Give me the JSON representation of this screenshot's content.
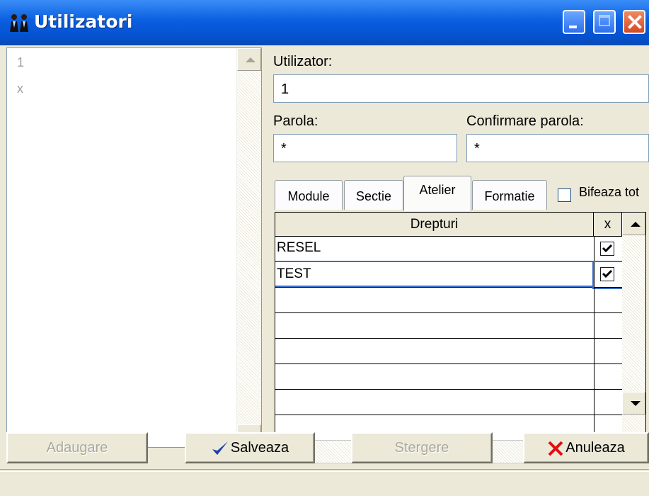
{
  "window": {
    "title": "Utilizatori"
  },
  "users_list": {
    "items": [
      "1",
      "x"
    ]
  },
  "form": {
    "user_label": "Utilizator:",
    "user_value": "1",
    "password_label": "Parola:",
    "password_value": "*",
    "confirm_label": "Confirmare parola:",
    "confirm_value": "*"
  },
  "tabs": [
    "Module",
    "Sectie",
    "Atelier",
    "Formatie"
  ],
  "active_tab": "Atelier",
  "check_all_label": "Bifeaza tot",
  "grid": {
    "columns": [
      "Drepturi",
      "x"
    ],
    "rows": [
      {
        "name": "RESEL",
        "checked": true
      },
      {
        "name": "TEST",
        "checked": true
      }
    ]
  },
  "buttons": {
    "add": "Adaugare",
    "save": "Salveaza",
    "delete": "Stergere",
    "cancel": "Anuleaza"
  },
  "colors": {
    "titlebar": "#0a5fe0",
    "check_icon": "#1b3fae",
    "cancel_icon": "#e01010"
  }
}
